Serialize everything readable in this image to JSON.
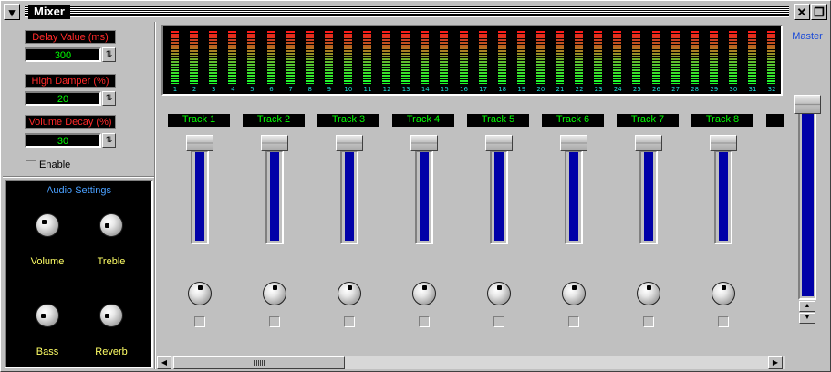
{
  "window": {
    "title": "Mixer",
    "sysmenu_glyph": "▾",
    "close_glyph": "✕",
    "restore_glyph": "❐"
  },
  "params": [
    {
      "label": "Delay Value (ms)",
      "value": "300"
    },
    {
      "label": "High Damper (%)",
      "value": "20"
    },
    {
      "label": "Volume Decay (%)",
      "value": "30"
    }
  ],
  "enable": {
    "label": "Enable",
    "checked": false
  },
  "audio_settings": {
    "title": "Audio Settings",
    "knobs": [
      "Volume",
      "Treble",
      "Bass",
      "Reverb"
    ]
  },
  "vu_meter": {
    "channels": [
      "1",
      "2",
      "3",
      "4",
      "5",
      "6",
      "7",
      "8",
      "9",
      "10",
      "11",
      "12",
      "13",
      "14",
      "15",
      "16",
      "17",
      "18",
      "19",
      "20",
      "21",
      "22",
      "23",
      "24",
      "25",
      "26",
      "27",
      "28",
      "29",
      "30",
      "31",
      "32"
    ]
  },
  "tracks": [
    {
      "label": "Track 1",
      "fader_level": 0.98
    },
    {
      "label": "Track 2",
      "fader_level": 0.98
    },
    {
      "label": "Track 3",
      "fader_level": 0.98
    },
    {
      "label": "Track 4",
      "fader_level": 0.98
    },
    {
      "label": "Track 5",
      "fader_level": 0.98
    },
    {
      "label": "Track 6",
      "fader_level": 0.98
    },
    {
      "label": "Track 7",
      "fader_level": 0.98
    },
    {
      "label": "Track 8",
      "fader_level": 0.98
    }
  ],
  "master": {
    "label": "Master",
    "level": 0.93
  },
  "colors": {
    "param_label_text": "#ff2a2a",
    "param_value_text": "#00ff00",
    "track_label_text": "#00ff00",
    "fader_fill": "#0000a8",
    "knob_label_text": "#ffff66",
    "audio_title_text": "#4aa0ff",
    "master_label_text": "#1a4ad8",
    "vu_number_text": "#20d8d8"
  },
  "icons": {
    "spin": "spinner-arrows-icon",
    "scroll_left": "arrow-left-icon",
    "scroll_right": "arrow-right-icon",
    "master_up": "arrow-up-icon",
    "master_down": "arrow-down-icon"
  }
}
